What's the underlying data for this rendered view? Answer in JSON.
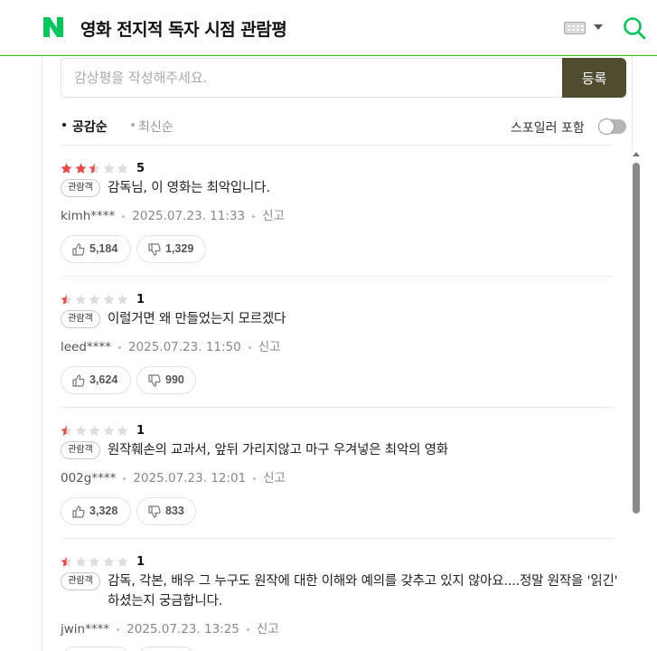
{
  "header": {
    "logo_letter": "N",
    "title": "영화 전지적 독자 시점 관람평",
    "icons": [
      "keyboard-icon",
      "chevron-down-icon",
      "search-icon"
    ],
    "brand_color": "#03c75a"
  },
  "write": {
    "placeholder": "감상평을 작성해주세요.",
    "submit_label": "등록",
    "submit_color": "#514c30"
  },
  "sort": {
    "options": [
      "공감순",
      "최신순"
    ],
    "selected": "공감순"
  },
  "spoiler": {
    "label": "스포일러 포함",
    "enabled": false
  },
  "reviews": [
    {
      "rating_stars": 2.5,
      "score": "5",
      "badge": "관람객",
      "text": "감독님, 이 영화는 최악입니다.",
      "author": "kimh****",
      "date": "2025.07.23. 11:33",
      "report": "신고",
      "likes": "5,184",
      "dislikes": "1,329"
    },
    {
      "rating_stars": 0.5,
      "score": "1",
      "badge": "관람객",
      "text": "이럴거면 왜 만들었는지 모르겠다",
      "author": "leed****",
      "date": "2025.07.23. 11:50",
      "report": "신고",
      "likes": "3,624",
      "dislikes": "990"
    },
    {
      "rating_stars": 0.5,
      "score": "1",
      "badge": "관람객",
      "text": "원작훼손의 교과서, 앞뒤 가리지않고 마구 우겨넣은 최악의 영화",
      "author": "002g****",
      "date": "2025.07.23. 12:01",
      "report": "신고",
      "likes": "3,328",
      "dislikes": "833"
    },
    {
      "rating_stars": 0.5,
      "score": "1",
      "badge": "관람객",
      "text": "감독, 각본, 배우 그 누구도 원작에 대한 이해와 예의를 갖추고 있지 않아요....정말 원작을 '읽긴' 하셨는지 궁금합니다.",
      "author": "jwin****",
      "date": "2025.07.23. 13:25",
      "report": "신고",
      "likes": "",
      "dislikes": ""
    }
  ],
  "colors": {
    "star_filled": "#f24646",
    "star_empty": "#dddddd"
  }
}
